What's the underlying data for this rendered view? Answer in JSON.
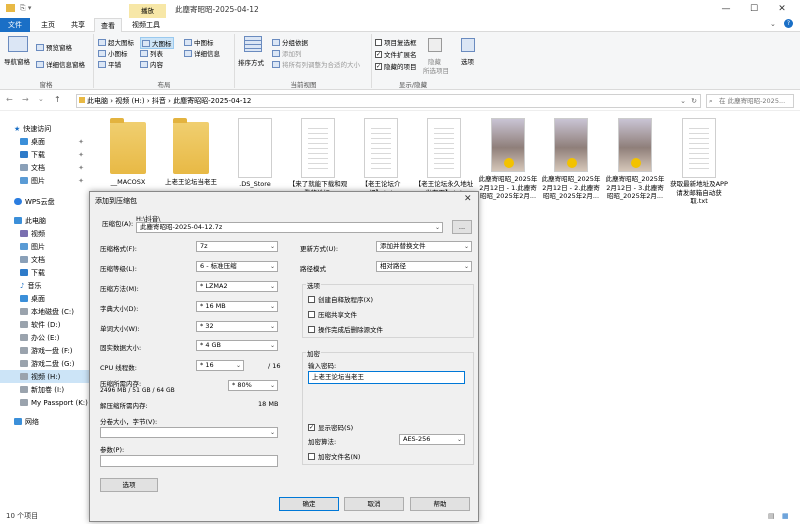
{
  "window": {
    "title": "此塵寄昭昭-2025-04-12",
    "context_tab": "播放"
  },
  "tabs": [
    "文件",
    "主页",
    "共享",
    "查看",
    "视频工具"
  ],
  "ribbon": {
    "panes": {
      "nav_pane": "导航窗格",
      "preview_pane": "预览窗格",
      "details_pane": "详细信息窗格",
      "label": "窗格"
    },
    "layout": {
      "items": [
        "超大图标",
        "大图标",
        "中图标",
        "小图标",
        "列表",
        "详细信息",
        "平铺",
        "内容"
      ],
      "label": "布局"
    },
    "current_view": {
      "sort": "排序方式",
      "group_by": "分组依据",
      "add_columns": "添加列",
      "size_all_columns": "将所有列调整为合适的大小",
      "label": "当前视图"
    },
    "show_hide": {
      "item_checkboxes": "项目复选框",
      "file_ext": "文件扩展名",
      "hidden_items": "隐藏的项目",
      "hide": "隐藏",
      "hide_selected": "所选项目",
      "options": "选项",
      "label": "显示/隐藏"
    }
  },
  "address": {
    "path": [
      "此电脑",
      "视频 (H:)",
      "抖音",
      "此塵寄昭昭-2025-04-12"
    ],
    "search_placeholder": "在 此塵寄昭昭-2025..."
  },
  "nav": {
    "quick_access": "快速访问",
    "items": [
      "桌面",
      "下载",
      "文档",
      "图片",
      "WPS云盘",
      "此电脑",
      "视频",
      "图片",
      "文档",
      "下载",
      "音乐",
      "桌面",
      "本地磁盘 (C:)",
      "软件 (D:)",
      "办公 (E:)",
      "游戏一盘 (F:)",
      "游戏二盘 (G:)",
      "视频 (H:)",
      "新加卷 (I:)",
      "My Passport (K:)",
      "网络"
    ]
  },
  "files": [
    {
      "name": "__MACOSX",
      "kind": "folder"
    },
    {
      "name": "上老王论坛当老王",
      "kind": "folder"
    },
    {
      "name": ".DS_Store",
      "kind": "doc"
    },
    {
      "name": "【来了就能下载和观看的论坛,",
      "kind": "txt"
    },
    {
      "name": "【老王论坛介绍】.txt",
      "kind": "txt"
    },
    {
      "name": "【老王论坛永久地址发布页】.txt",
      "kind": "txt"
    },
    {
      "name": "此塵寄昭昭_2025年2月12日 - 1.此塵寄昭昭_2025年2月...",
      "kind": "img"
    },
    {
      "name": "此塵寄昭昭_2025年2月12日 - 2.此塵寄昭昭_2025年2月...",
      "kind": "img"
    },
    {
      "name": "此塵寄昭昭_2025年2月12日 - 3.此塵寄昭昭_2025年2月...",
      "kind": "img"
    },
    {
      "name": "获取最新地址及APP请发邮箱自动获取.txt",
      "kind": "txt"
    }
  ],
  "status": {
    "count": "10 个项目"
  },
  "dialog": {
    "title": "添加到压缩包",
    "archive_label": "压缩包(A):",
    "archive_path": "H:\\抖音\\",
    "archive_name": "此塵寄昭昭-2025-04-12.7z",
    "browse": "...",
    "left_rows": [
      {
        "label": "压缩格式(F):",
        "value": "7z"
      },
      {
        "label": "压缩等级(L):",
        "value": "6 - 标准压缩"
      },
      {
        "label": "压缩方法(M):",
        "value": "* LZMA2"
      },
      {
        "label": "字典大小(D):",
        "value": "* 16 MB"
      },
      {
        "label": "单词大小(W):",
        "value": "* 32"
      },
      {
        "label": "固实数据大小:",
        "value": "* 4 GB"
      },
      {
        "label": "CPU 线程数:",
        "value": "* 16"
      }
    ],
    "cpu_total": "/ 16",
    "mem_label": "压缩所需内存:",
    "mem_value": "2496 MB / 51 GB / 64 GB",
    "mem_pct": "* 80%",
    "decomp_label": "解压缩所需内存:",
    "decomp_value": "18 MB",
    "split_label": "分卷大小，字节(V):",
    "params_label": "参数(P):",
    "options_btn": "选项",
    "update_label": "更新方式(U):",
    "update_value": "添加并替换文件",
    "path_label": "路径模式",
    "path_value": "相对路径",
    "options_group": "选项",
    "opt_sfx": "创建自释放程序(X)",
    "opt_shared": "压缩共享文件",
    "opt_delete": "操作完成后删除源文件",
    "enc_group": "加密",
    "pwd_label": "输入密码:",
    "pwd_value": "上老王论坛当老王",
    "show_pwd": "显示密码(S)",
    "enc_method_label": "加密算法:",
    "enc_method_value": "AES-256",
    "enc_names": "加密文件名(N)",
    "ok": "确定",
    "cancel": "取消",
    "help": "帮助"
  }
}
